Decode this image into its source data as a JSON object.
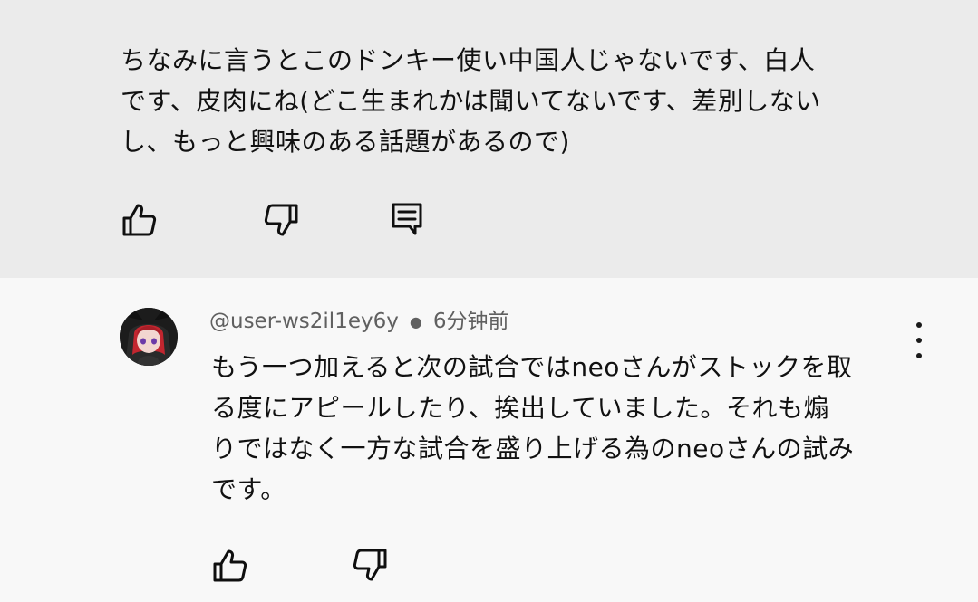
{
  "top_comment": {
    "text": "ちなみに言うとこのドンキー使い中国人じゃないです、白人\nです、皮肉にね(どこ生まれかは聞いてないです、差別しない\nし、もっと興味のある話題があるので)",
    "actions": {
      "like_icon": "thumbs-up-icon",
      "dislike_icon": "thumbs-down-icon",
      "reply_icon": "comment-reply-icon"
    }
  },
  "reply": {
    "username": "@user-ws2il1ey6y",
    "timestamp": "6分钟前",
    "text": "もう一つ加えると次の試合ではneoさんがストックを取\nる度にアピールしたり、挨出していました。それも煽\nりではなく一方な試合を盛り上げる為のneoさんの試み\nです。",
    "actions": {
      "like_icon": "thumbs-up-icon",
      "dislike_icon": "thumbs-down-icon",
      "more_icon": "more-vertical-icon"
    }
  },
  "colors": {
    "top_background": "#ebebeb",
    "bottom_background": "#f8f8f8",
    "text": "#111111",
    "meta_text": "#606060",
    "avatar_hair": "#c3262f"
  }
}
